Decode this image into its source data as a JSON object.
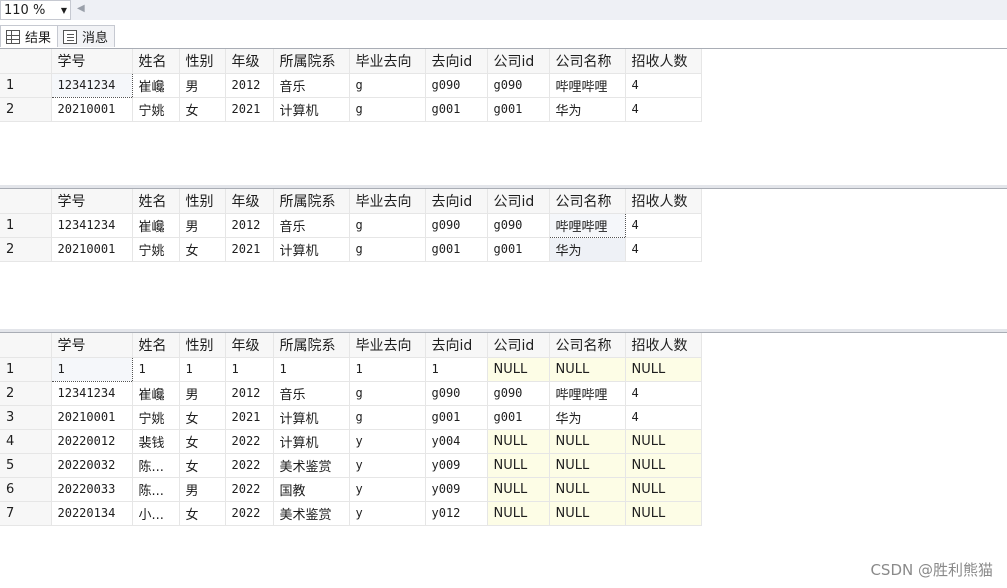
{
  "toolbar": {
    "zoom_value": "110 %"
  },
  "tabs": [
    {
      "label": "结果",
      "icon": "grid-icon"
    },
    {
      "label": "消息",
      "icon": "messages-icon"
    }
  ],
  "columns": [
    "学号",
    "姓名",
    "性别",
    "年级",
    "所属院系",
    "毕业去向",
    "去向id",
    "公司id",
    "公司名称",
    "招收人数"
  ],
  "result1": [
    [
      "1",
      "12341234",
      "崔巉",
      "男",
      "2012",
      "音乐",
      "g",
      "g090",
      "g090",
      "哔哩哔哩",
      "4"
    ],
    [
      "2",
      "20210001",
      "宁姚",
      "女",
      "2021",
      "计算机",
      "g",
      "g001",
      "g001",
      "华为",
      "4"
    ]
  ],
  "result2": [
    [
      "1",
      "12341234",
      "崔巉",
      "男",
      "2012",
      "音乐",
      "g",
      "g090",
      "g090",
      "哔哩哔哩",
      "4"
    ],
    [
      "2",
      "20210001",
      "宁姚",
      "女",
      "2021",
      "计算机",
      "g",
      "g001",
      "g001",
      "华为",
      "4"
    ]
  ],
  "result3": [
    [
      "1",
      "1",
      "1",
      "1",
      "1",
      "1",
      "1",
      "1",
      "NULL",
      "NULL",
      "NULL"
    ],
    [
      "2",
      "12341234",
      "崔巉",
      "男",
      "2012",
      "音乐",
      "g",
      "g090",
      "g090",
      "哔哩哔哩",
      "4"
    ],
    [
      "3",
      "20210001",
      "宁姚",
      "女",
      "2021",
      "计算机",
      "g",
      "g001",
      "g001",
      "华为",
      "4"
    ],
    [
      "4",
      "20220012",
      "裴钱",
      "女",
      "2022",
      "计算机",
      "y",
      "y004",
      "NULL",
      "NULL",
      "NULL"
    ],
    [
      "5",
      "20220032",
      "陈...",
      "女",
      "2022",
      "美术鉴赏",
      "y",
      "y009",
      "NULL",
      "NULL",
      "NULL"
    ],
    [
      "6",
      "20220033",
      "陈...",
      "男",
      "2022",
      "国教",
      "y",
      "y009",
      "NULL",
      "NULL",
      "NULL"
    ],
    [
      "7",
      "20220134",
      "小...",
      "女",
      "2022",
      "美术鉴赏",
      "y",
      "y012",
      "NULL",
      "NULL",
      "NULL"
    ]
  ],
  "watermark": "CSDN @胜利熊猫"
}
